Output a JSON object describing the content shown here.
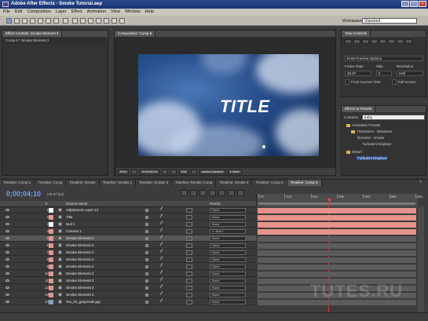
{
  "window": {
    "title": "Adobe After Effects - Smoke Tutorial.aep"
  },
  "menu": [
    "File",
    "Edit",
    "Composition",
    "Layer",
    "Effect",
    "Animation",
    "View",
    "Window",
    "Help"
  ],
  "toolbar": {
    "workspace_label": "Workspace:",
    "workspace_value": "Standard"
  },
  "effect_controls": {
    "tab": "Effect Controls: Smoke Element 2",
    "subtitle": "Comp 6 * Smoke Element 2"
  },
  "composition": {
    "tab": "Composition: Comp 6",
    "overlay_title": "TITLE",
    "viewer": {
      "zoom": "50%",
      "timecode": "0;00;04;10",
      "quality": "Full",
      "camera": "Active Camera",
      "view": "1 View"
    }
  },
  "time_controls": {
    "tab": "Time Controls",
    "ram_preview": "RAM Preview Options",
    "frame_rate_label": "Frame Rate",
    "skip_label": "Skip",
    "resolution_label": "Resolution",
    "frame_rate": "29.97",
    "skip": "0",
    "resolution": "Half",
    "from_current": "From Current Time",
    "full_screen": "Full Screen"
  },
  "effects_presets": {
    "tab": "Effects & Presets",
    "contains_label": "Contains:",
    "search_value": "turbu",
    "tree": [
      "Animation Presets",
      "Transitions - Dissolves",
      "Dissolve - smoke",
      "Turbulent Displace",
      "Distort",
      "Turbulent Displace"
    ]
  },
  "timeline": {
    "tabs": [
      "Timeline: Comp 1",
      "Timeline: Comp",
      "Timeline: Smoke",
      "Timeline: Smoke 2",
      "Timeline: Smoke 3",
      "Timeline: Render Comp",
      "Timeline: Smoke 4",
      "Timeline: Comp 5",
      "Timeline: Comp 6"
    ],
    "timecode": "0;00;04;10",
    "fps": "(29.97 fps)",
    "headers": {
      "num": "#",
      "source_name": "Source Name",
      "parent": "Parent"
    },
    "ruler_labels": [
      "0s",
      "01s",
      "02s",
      "03s",
      "04s",
      "05s",
      "06s"
    ],
    "layers": [
      {
        "num": "1",
        "name": "Adjustment Layer 10",
        "parent": "None",
        "color": "#ffffff",
        "pink": true
      },
      {
        "num": "2",
        "name": "Title",
        "parent": "None",
        "color": "#e5938c",
        "pink": true
      },
      {
        "num": "3",
        "name": "Null 1",
        "parent": "None",
        "color": "#ffffff",
        "pink": true
      },
      {
        "num": "4",
        "name": "Camera 1",
        "parent": "1. Null 1",
        "color": "#e5938c",
        "pink": true
      },
      {
        "num": "5",
        "name": "Smoke Element 2",
        "parent": "None",
        "color": "#e5938c",
        "pink": false,
        "selected": true
      },
      {
        "num": "6",
        "name": "Smoke Element 2",
        "parent": "None",
        "color": "#e5938c",
        "pink": false
      },
      {
        "num": "7",
        "name": "Smoke Element 2",
        "parent": "None",
        "color": "#e5938c",
        "pink": false
      },
      {
        "num": "8",
        "name": "Smoke Element 2",
        "parent": "None",
        "color": "#e5938c",
        "pink": false
      },
      {
        "num": "9",
        "name": "Smoke Element 2",
        "parent": "None",
        "color": "#e5938c",
        "pink": false
      },
      {
        "num": "10",
        "name": "Smoke Element 2",
        "parent": "None",
        "color": "#e5938c",
        "pink": false
      },
      {
        "num": "11",
        "name": "Smoke Element 2",
        "parent": "None",
        "color": "#e5938c",
        "pink": false
      },
      {
        "num": "12",
        "name": "Smoke Element 2",
        "parent": "None",
        "color": "#e5938c",
        "pink": false
      },
      {
        "num": "13",
        "name": "Smoke Element 2",
        "parent": "None",
        "color": "#e5938c",
        "pink": false
      },
      {
        "num": "14",
        "name": "Tex_01_grayscale.jpg",
        "parent": "None",
        "color": "#8a9dc9",
        "pink": false
      }
    ]
  },
  "watermark": "TUTES.RU"
}
